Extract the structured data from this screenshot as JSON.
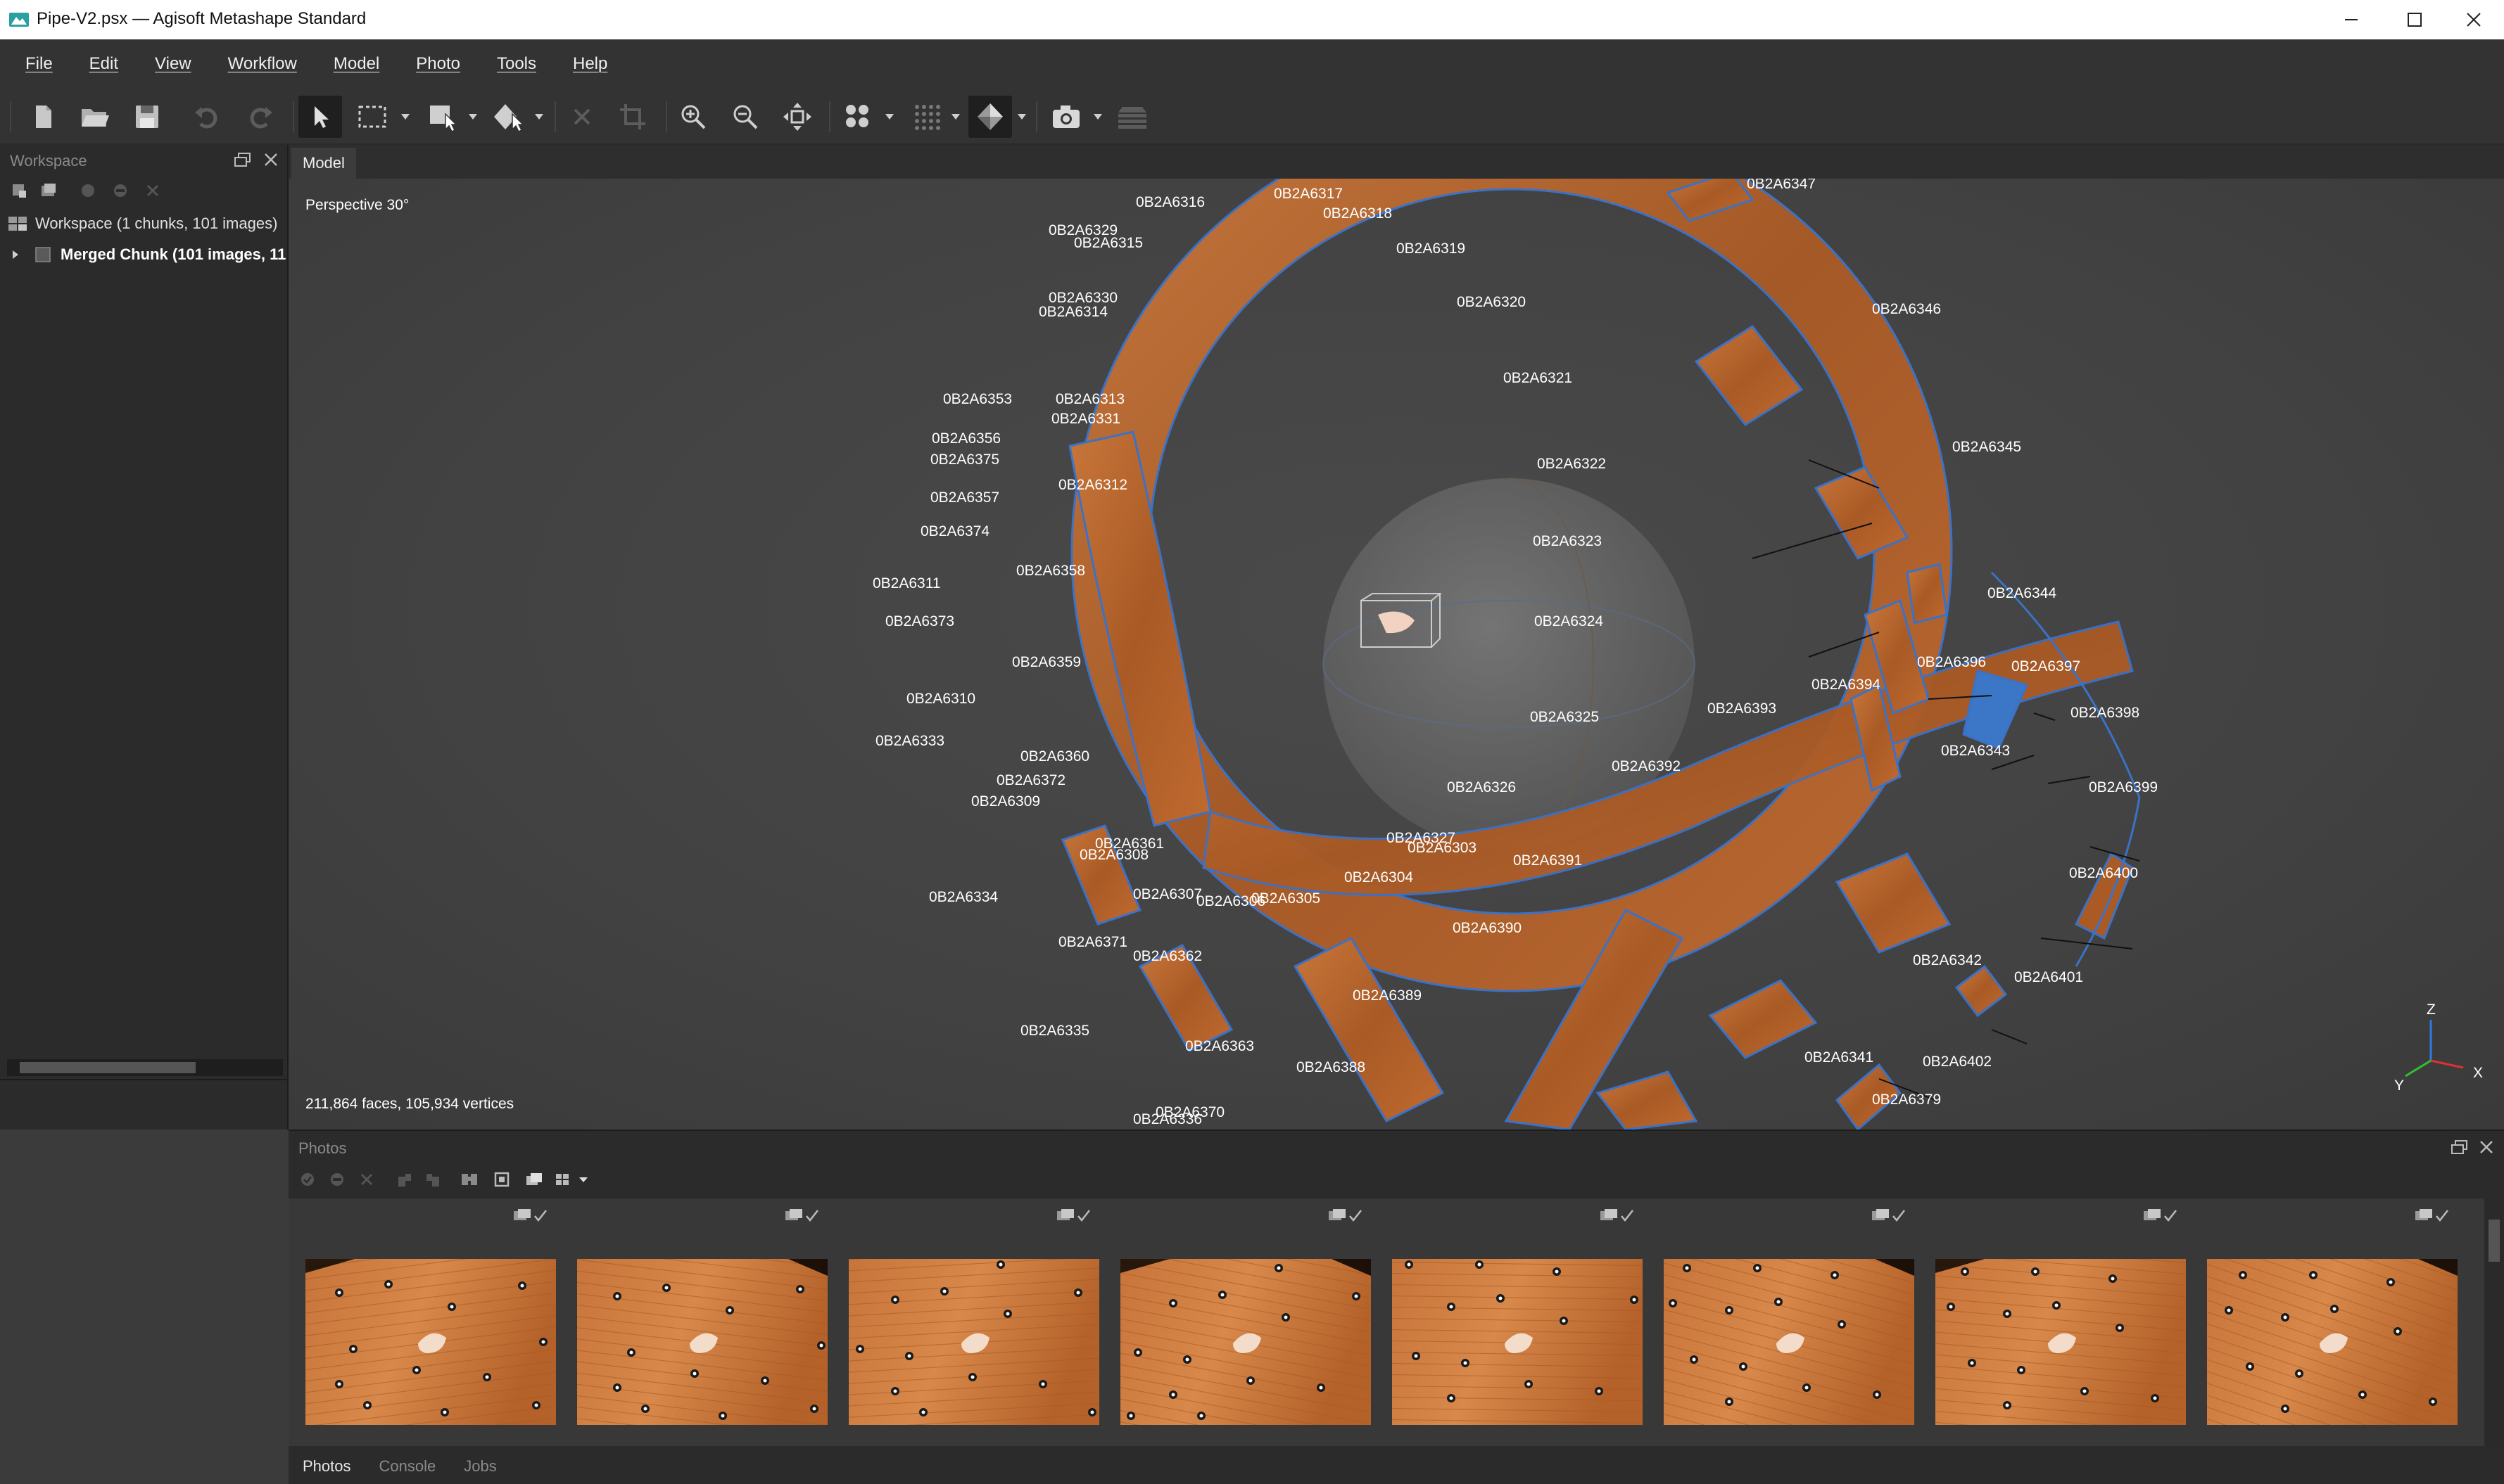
{
  "app": {
    "title": "Pipe-V2.psx — Agisoft Metashape Standard",
    "icon": "metashape-app-icon"
  },
  "window_controls": {
    "minimize": "minimize-icon",
    "maximize": "maximize-icon",
    "close": "close-icon"
  },
  "menu": [
    "File",
    "Edit",
    "View",
    "Workflow",
    "Model",
    "Photo",
    "Tools",
    "Help"
  ],
  "toolbar": {
    "icons": [
      "new-document-icon",
      "open-folder-icon",
      "save-icon",
      "undo-icon",
      "redo-icon",
      "select-pointer-icon",
      "rectangle-selection-icon",
      "navigation-mode-icon",
      "shape-mode-icon",
      "delete-icon",
      "crop-icon",
      "zoom-in-icon",
      "zoom-out-icon",
      "reset-view-icon",
      "show-points-icon",
      "show-dense-icon",
      "model-shaded-icon",
      "show-cameras-icon",
      "show-layers-icon"
    ]
  },
  "workspace": {
    "panel_title": "Workspace",
    "root_label": "Workspace (1 chunks, 101 images)",
    "chunk_label": "Merged Chunk (101 images, 11"
  },
  "model_view": {
    "tab_label": "Model",
    "projection": "Perspective 30°",
    "stats": "211,864 faces, 105,934 vertices",
    "axes": {
      "z": "Z",
      "x": "X",
      "y": "Y"
    },
    "camera_labels": [
      "0B2A6316",
      "0B2A6317",
      "0B2A6318",
      "0B2A6329",
      "0B2A6315",
      "0B2A6319",
      "0B2A6320",
      "0B2A6330",
      "0B2A6314",
      "0B2A6321",
      "0B2A6353",
      "0B2A6313",
      "0B2A6331",
      "0B2A6356",
      "0B2A6322",
      "0B2A6375",
      "0B2A6312",
      "0B2A6357",
      "0B2A6374",
      "0B2A6323",
      "0B2A6358",
      "0B2A6311",
      "0B2A6373",
      "0B2A6324",
      "0B2A6359",
      "0B2A6310",
      "0B2A6325",
      "0B2A6333",
      "0B2A6360",
      "0B2A6372",
      "0B2A6309",
      "0B2A6326",
      "0B2A6361",
      "0B2A6308",
      "0B2A6327",
      "0B2A6303",
      "0B2A6304",
      "0B2A6391",
      "0B2A6334",
      "0B2A6307",
      "0B2A6306",
      "0B2A6305",
      "0B2A6390",
      "0B2A6371",
      "0B2A6362",
      "0B2A6335",
      "0B2A6389",
      "0B2A6363",
      "0B2A6388",
      "0B2A6370",
      "0B2A6336",
      "0B2A6347",
      "0B2A6346",
      "0B2A6345",
      "0B2A6344",
      "0B2A6396",
      "0B2A6397",
      "0B2A6394",
      "0B2A6398",
      "0B2A6393",
      "0B2A6343",
      "0B2A6392",
      "0B2A6399",
      "0B2A6400",
      "0B2A6342",
      "0B2A6401",
      "0B2A6341",
      "0B2A6402",
      "0B2A6379"
    ]
  },
  "photos_panel": {
    "panel_title": "Photos",
    "tools": [
      "enable-camera-icon",
      "disable-camera-icon",
      "remove-camera-icon",
      "rotate-left-icon",
      "rotate-right-icon",
      "filter-icon",
      "reset-filter-icon",
      "show-icon",
      "view-mode-icon"
    ],
    "thumbnails": [
      {
        "flag": "camera-aligned-icon"
      },
      {
        "flag": "camera-aligned-icon"
      },
      {
        "flag": "camera-aligned-icon"
      },
      {
        "flag": "camera-aligned-icon"
      },
      {
        "flag": "camera-aligned-icon"
      },
      {
        "flag": "camera-aligned-icon"
      },
      {
        "flag": "camera-aligned-icon"
      },
      {
        "flag": "camera-aligned-icon"
      }
    ],
    "tabs": [
      "Photos",
      "Console",
      "Jobs"
    ]
  },
  "colors": {
    "background": "#3b3b3b",
    "panel": "#2b2b2b",
    "toolbar": "#333333",
    "wood": "#b5652a",
    "camera_outline": "#3a72c8",
    "selected_camera": "#3c76c6"
  }
}
